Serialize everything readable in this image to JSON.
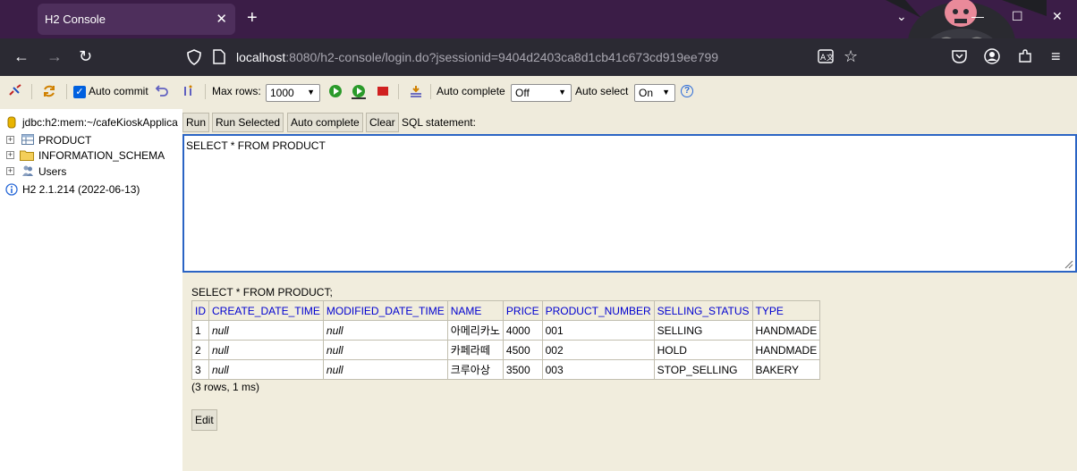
{
  "browser": {
    "tab_title": "H2 Console",
    "url_host": "localhost",
    "url_rest": ":8080/h2-console/login.do?jsessionid=9404d2403ca8d1cb41c673cd919ee799"
  },
  "toolbar": {
    "auto_commit_label": "Auto commit",
    "max_rows_label": "Max rows:",
    "max_rows_value": "1000",
    "auto_complete_label": "Auto complete",
    "auto_complete_value": "Off",
    "auto_select_label": "Auto select",
    "auto_select_value": "On",
    "help_glyph": "?"
  },
  "tree": {
    "connection": "jdbc:h2:mem:~/cafeKioskApplica",
    "items": [
      {
        "label": "PRODUCT",
        "icon": "table-icon"
      },
      {
        "label": "INFORMATION_SCHEMA",
        "icon": "folder-icon"
      },
      {
        "label": "Users",
        "icon": "users-icon"
      }
    ],
    "version": "H2 2.1.214 (2022-06-13)"
  },
  "query": {
    "run_label": "Run",
    "run_selected_label": "Run Selected",
    "auto_complete_label": "Auto complete",
    "clear_label": "Clear",
    "statement_label": "SQL statement:",
    "sql_text": "SELECT * FROM PRODUCT"
  },
  "results": {
    "executed_sql": "SELECT * FROM PRODUCT;",
    "columns": [
      "ID",
      "CREATE_DATE_TIME",
      "MODIFIED_DATE_TIME",
      "NAME",
      "PRICE",
      "PRODUCT_NUMBER",
      "SELLING_STATUS",
      "TYPE"
    ],
    "rows": [
      [
        "1",
        "null",
        "null",
        "아메리카노",
        "4000",
        "001",
        "SELLING",
        "HANDMADE"
      ],
      [
        "2",
        "null",
        "null",
        "카페라떼",
        "4500",
        "002",
        "HOLD",
        "HANDMADE"
      ],
      [
        "3",
        "null",
        "null",
        "크루아상",
        "3500",
        "003",
        "STOP_SELLING",
        "BAKERY"
      ]
    ],
    "row_count": "(3 rows, 1 ms)",
    "edit_label": "Edit"
  },
  "colors": {
    "tabstrip": "#3b1d47",
    "navbar": "#2b2a33",
    "panel": "#efebdc",
    "header_text": "#0000d0",
    "editor_border": "#2b64c4"
  }
}
